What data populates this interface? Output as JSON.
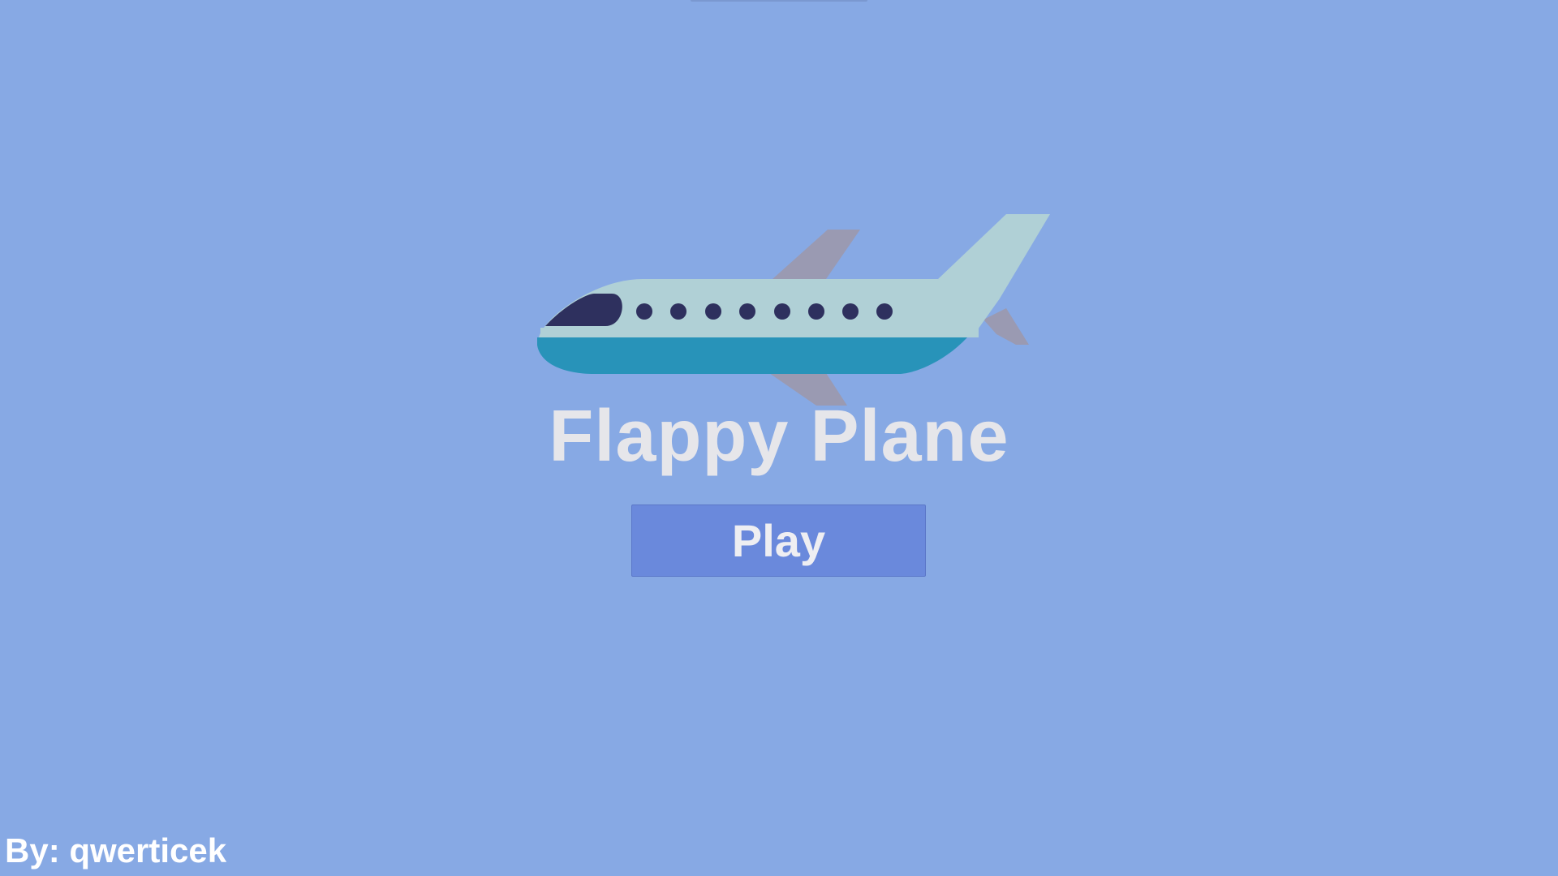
{
  "game": {
    "title": "Flappy Plane",
    "play_label": "Play",
    "author_credit": "By: qwerticek"
  },
  "logo": {
    "icon": "airplane-icon"
  },
  "colors": {
    "background": "#87a9e4",
    "title_text": "#e6e6ea",
    "button_fill": "#6a89dc",
    "plane_body": "#b0d0d6",
    "plane_belly": "#2893b9",
    "plane_wing": "#9a9ab2",
    "plane_window": "#2e305e"
  }
}
